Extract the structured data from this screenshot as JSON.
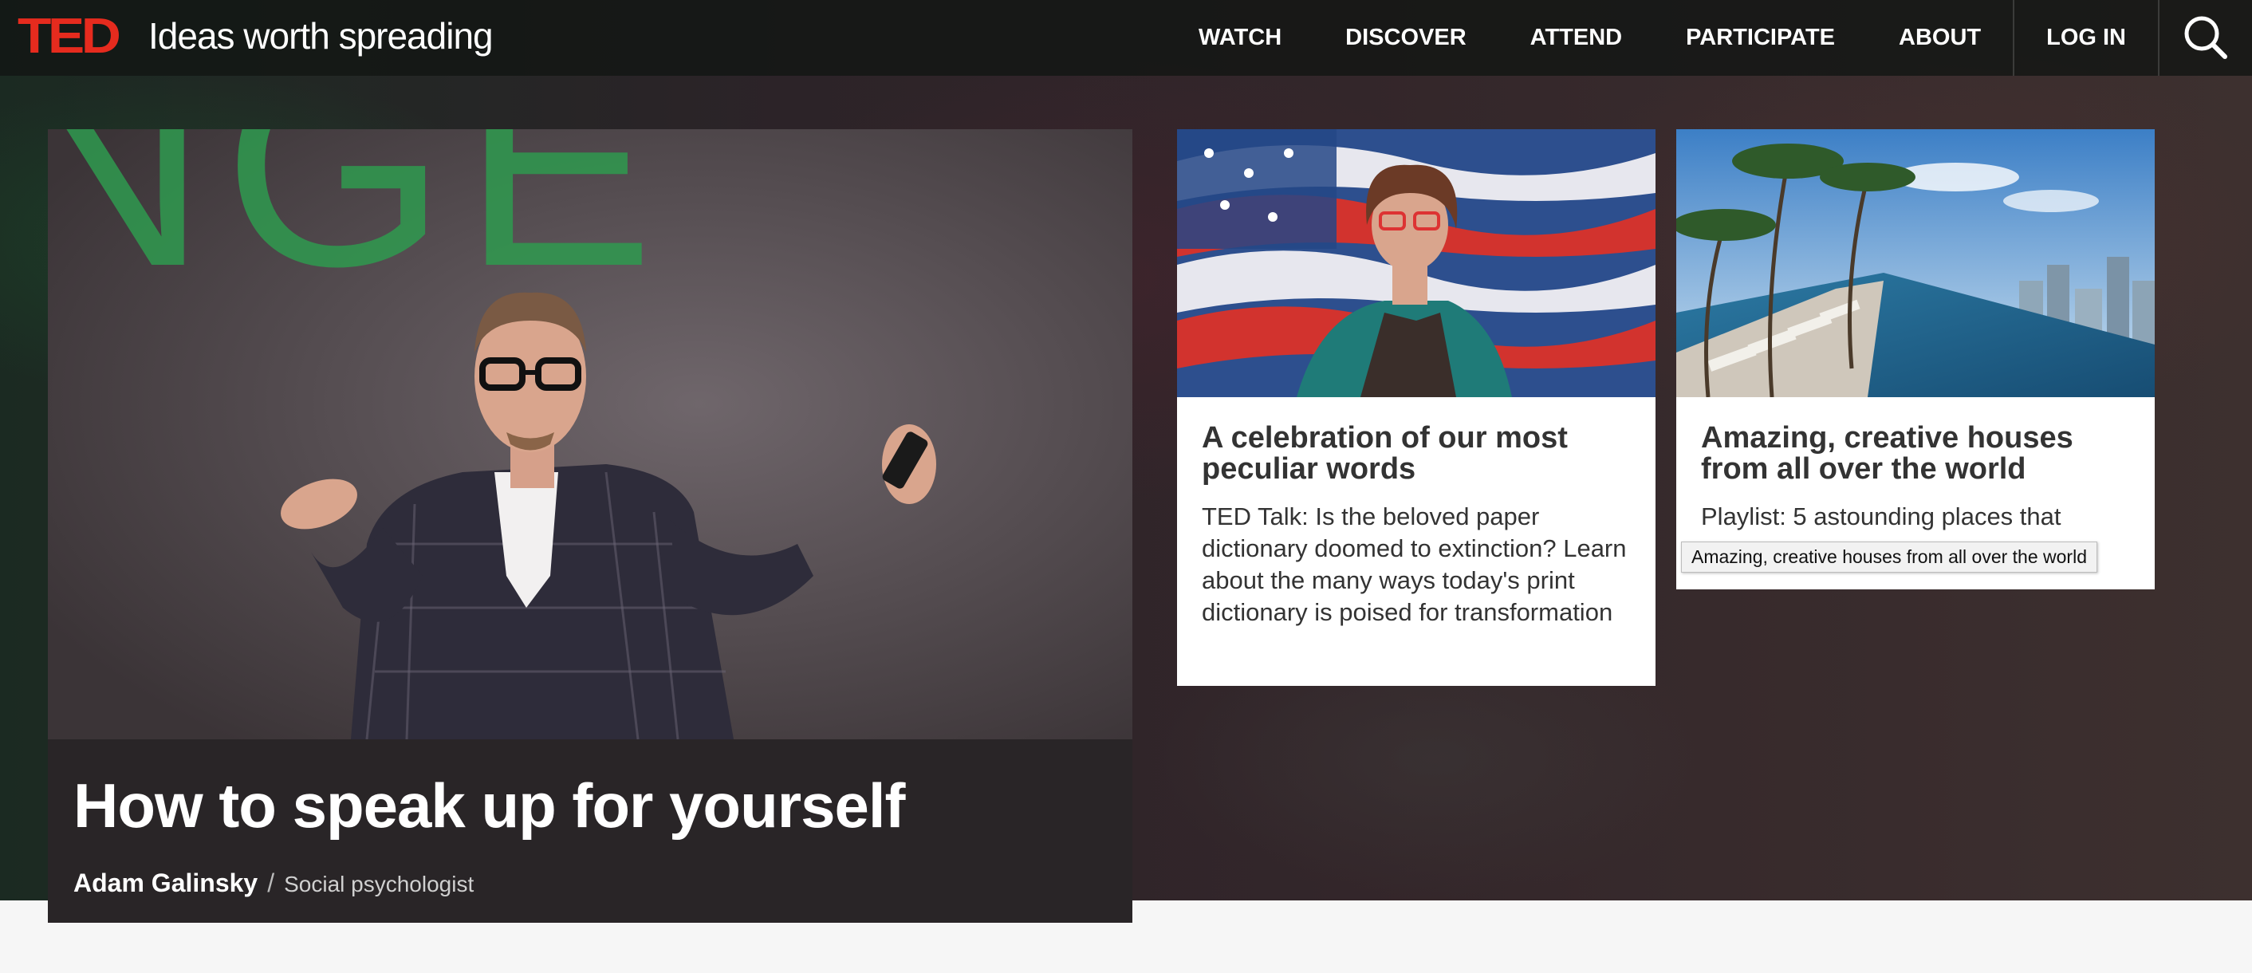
{
  "header": {
    "logo": "TED",
    "tagline": "Ideas worth spreading",
    "nav": [
      "WATCH",
      "DISCOVER",
      "ATTEND",
      "PARTICIPATE",
      "ABOUT"
    ],
    "login": "LOG IN",
    "search_icon": "search-icon"
  },
  "feature": {
    "title": "How to speak up for yourself",
    "speaker": "Adam Galinsky",
    "separator": "/",
    "role": "Social psychologist",
    "backdrop_letters": "NGE"
  },
  "cards": [
    {
      "title": "A celebration of our most peculiar words",
      "description": "TED Talk: Is the beloved paper dictionary doomed to extinction? Learn about the many ways today's print dictionary is poised for transformation"
    },
    {
      "title": "Amazing, creative houses from all over the world",
      "description": "Playlist: 5 astounding places that"
    }
  ],
  "tooltip": "Amazing, creative houses from all over the world",
  "colors": {
    "brand_red": "#e62b1e",
    "header_bg": "#121614",
    "card_bg": "#ffffff",
    "page_bg": "#f6f6f6"
  }
}
